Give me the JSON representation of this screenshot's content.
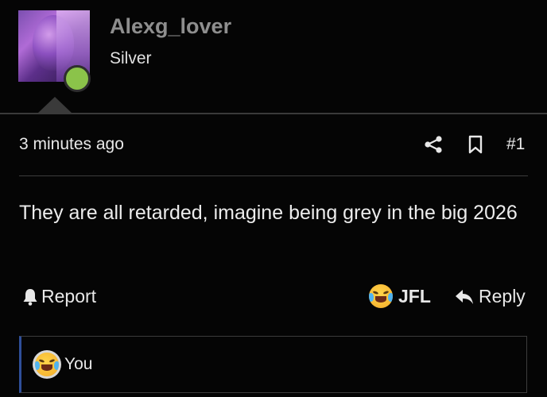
{
  "user": {
    "username": "Alexg_lover",
    "title": "Silver",
    "online": true,
    "online_color": "#8bc34a"
  },
  "post": {
    "timestamp": "3 minutes ago",
    "number": "#1",
    "message": "They are all retarded, imagine being grey in the big 2026"
  },
  "actions": {
    "report_label": "Report",
    "reaction_label": "JFL",
    "reaction_icon": "face-with-tears-of-joy-emoji",
    "reply_label": "Reply"
  },
  "reactions_box": {
    "label": "You",
    "accent": "#2f4f9a"
  },
  "icons": {
    "share": "share-icon",
    "bookmark": "bookmark-icon",
    "report": "bell-icon",
    "reply": "reply-arrow-icon"
  }
}
